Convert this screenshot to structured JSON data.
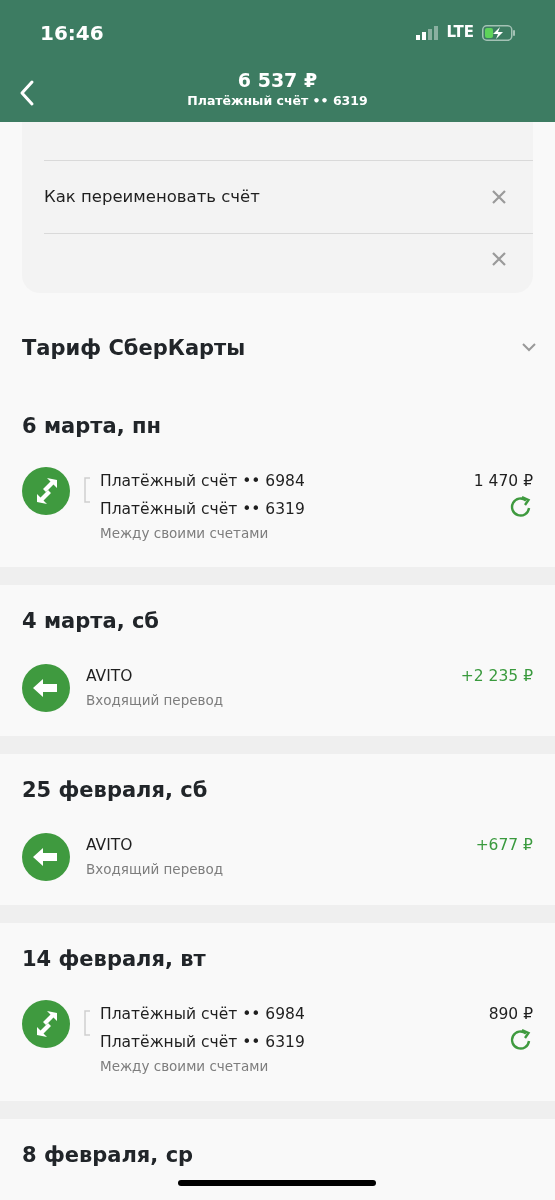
{
  "status_bar": {
    "time": "16:46",
    "network": "LTE"
  },
  "header": {
    "amount": "6 537 ₽",
    "account": "Платёжный счёт •• 6319"
  },
  "suggestions": [
    {
      "kind": "full",
      "text": "Как переименовать счёт"
    },
    {
      "kind": "cut"
    }
  ],
  "tariff": {
    "title": "Тариф СберКарты",
    "expanded": false
  },
  "days": [
    {
      "date": "6 марта, пн",
      "transactions": [
        {
          "kind": "transfer",
          "from": "Платёжный счёт •• 6984",
          "to": "Платёжный счёт •• 6319",
          "note": "Между своими счетами",
          "amount": "1 470 ₽",
          "repeat": true
        }
      ]
    },
    {
      "date": "4 марта, сб",
      "transactions": [
        {
          "kind": "incoming",
          "title": "AVITO",
          "note": "Входящий перевод",
          "amount": "+2 235 ₽"
        }
      ]
    },
    {
      "date": "25 февраля, сб",
      "transactions": [
        {
          "kind": "incoming",
          "title": "AVITO",
          "note": "Входящий перевод",
          "amount": "+677 ₽"
        }
      ]
    },
    {
      "date": "14 февраля, вт",
      "transactions": [
        {
          "kind": "transfer",
          "from": "Платёжный счёт •• 6984",
          "to": "Платёжный счёт •• 6319",
          "note": "Между своими счетами",
          "amount": "890 ₽",
          "repeat": true
        }
      ]
    },
    {
      "date": "8 февраля, ср"
    }
  ]
}
